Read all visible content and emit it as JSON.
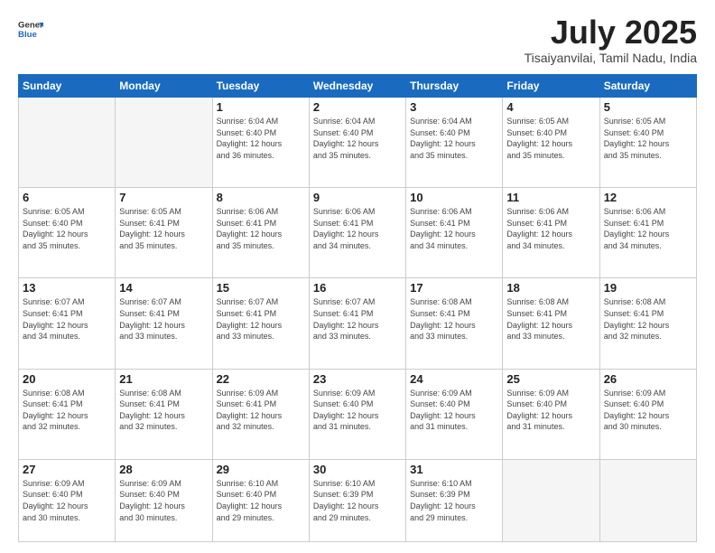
{
  "header": {
    "logo_general": "General",
    "logo_blue": "Blue",
    "month_title": "July 2025",
    "location": "Tisaiyanvilai, Tamil Nadu, India"
  },
  "weekdays": [
    "Sunday",
    "Monday",
    "Tuesday",
    "Wednesday",
    "Thursday",
    "Friday",
    "Saturday"
  ],
  "weeks": [
    [
      {
        "day": "",
        "info": ""
      },
      {
        "day": "",
        "info": ""
      },
      {
        "day": "1",
        "info": "Sunrise: 6:04 AM\nSunset: 6:40 PM\nDaylight: 12 hours\nand 36 minutes."
      },
      {
        "day": "2",
        "info": "Sunrise: 6:04 AM\nSunset: 6:40 PM\nDaylight: 12 hours\nand 35 minutes."
      },
      {
        "day": "3",
        "info": "Sunrise: 6:04 AM\nSunset: 6:40 PM\nDaylight: 12 hours\nand 35 minutes."
      },
      {
        "day": "4",
        "info": "Sunrise: 6:05 AM\nSunset: 6:40 PM\nDaylight: 12 hours\nand 35 minutes."
      },
      {
        "day": "5",
        "info": "Sunrise: 6:05 AM\nSunset: 6:40 PM\nDaylight: 12 hours\nand 35 minutes."
      }
    ],
    [
      {
        "day": "6",
        "info": "Sunrise: 6:05 AM\nSunset: 6:40 PM\nDaylight: 12 hours\nand 35 minutes."
      },
      {
        "day": "7",
        "info": "Sunrise: 6:05 AM\nSunset: 6:41 PM\nDaylight: 12 hours\nand 35 minutes."
      },
      {
        "day": "8",
        "info": "Sunrise: 6:06 AM\nSunset: 6:41 PM\nDaylight: 12 hours\nand 35 minutes."
      },
      {
        "day": "9",
        "info": "Sunrise: 6:06 AM\nSunset: 6:41 PM\nDaylight: 12 hours\nand 34 minutes."
      },
      {
        "day": "10",
        "info": "Sunrise: 6:06 AM\nSunset: 6:41 PM\nDaylight: 12 hours\nand 34 minutes."
      },
      {
        "day": "11",
        "info": "Sunrise: 6:06 AM\nSunset: 6:41 PM\nDaylight: 12 hours\nand 34 minutes."
      },
      {
        "day": "12",
        "info": "Sunrise: 6:06 AM\nSunset: 6:41 PM\nDaylight: 12 hours\nand 34 minutes."
      }
    ],
    [
      {
        "day": "13",
        "info": "Sunrise: 6:07 AM\nSunset: 6:41 PM\nDaylight: 12 hours\nand 34 minutes."
      },
      {
        "day": "14",
        "info": "Sunrise: 6:07 AM\nSunset: 6:41 PM\nDaylight: 12 hours\nand 33 minutes."
      },
      {
        "day": "15",
        "info": "Sunrise: 6:07 AM\nSunset: 6:41 PM\nDaylight: 12 hours\nand 33 minutes."
      },
      {
        "day": "16",
        "info": "Sunrise: 6:07 AM\nSunset: 6:41 PM\nDaylight: 12 hours\nand 33 minutes."
      },
      {
        "day": "17",
        "info": "Sunrise: 6:08 AM\nSunset: 6:41 PM\nDaylight: 12 hours\nand 33 minutes."
      },
      {
        "day": "18",
        "info": "Sunrise: 6:08 AM\nSunset: 6:41 PM\nDaylight: 12 hours\nand 33 minutes."
      },
      {
        "day": "19",
        "info": "Sunrise: 6:08 AM\nSunset: 6:41 PM\nDaylight: 12 hours\nand 32 minutes."
      }
    ],
    [
      {
        "day": "20",
        "info": "Sunrise: 6:08 AM\nSunset: 6:41 PM\nDaylight: 12 hours\nand 32 minutes."
      },
      {
        "day": "21",
        "info": "Sunrise: 6:08 AM\nSunset: 6:41 PM\nDaylight: 12 hours\nand 32 minutes."
      },
      {
        "day": "22",
        "info": "Sunrise: 6:09 AM\nSunset: 6:41 PM\nDaylight: 12 hours\nand 32 minutes."
      },
      {
        "day": "23",
        "info": "Sunrise: 6:09 AM\nSunset: 6:40 PM\nDaylight: 12 hours\nand 31 minutes."
      },
      {
        "day": "24",
        "info": "Sunrise: 6:09 AM\nSunset: 6:40 PM\nDaylight: 12 hours\nand 31 minutes."
      },
      {
        "day": "25",
        "info": "Sunrise: 6:09 AM\nSunset: 6:40 PM\nDaylight: 12 hours\nand 31 minutes."
      },
      {
        "day": "26",
        "info": "Sunrise: 6:09 AM\nSunset: 6:40 PM\nDaylight: 12 hours\nand 30 minutes."
      }
    ],
    [
      {
        "day": "27",
        "info": "Sunrise: 6:09 AM\nSunset: 6:40 PM\nDaylight: 12 hours\nand 30 minutes."
      },
      {
        "day": "28",
        "info": "Sunrise: 6:09 AM\nSunset: 6:40 PM\nDaylight: 12 hours\nand 30 minutes."
      },
      {
        "day": "29",
        "info": "Sunrise: 6:10 AM\nSunset: 6:40 PM\nDaylight: 12 hours\nand 29 minutes."
      },
      {
        "day": "30",
        "info": "Sunrise: 6:10 AM\nSunset: 6:39 PM\nDaylight: 12 hours\nand 29 minutes."
      },
      {
        "day": "31",
        "info": "Sunrise: 6:10 AM\nSunset: 6:39 PM\nDaylight: 12 hours\nand 29 minutes."
      },
      {
        "day": "",
        "info": ""
      },
      {
        "day": "",
        "info": ""
      }
    ]
  ]
}
